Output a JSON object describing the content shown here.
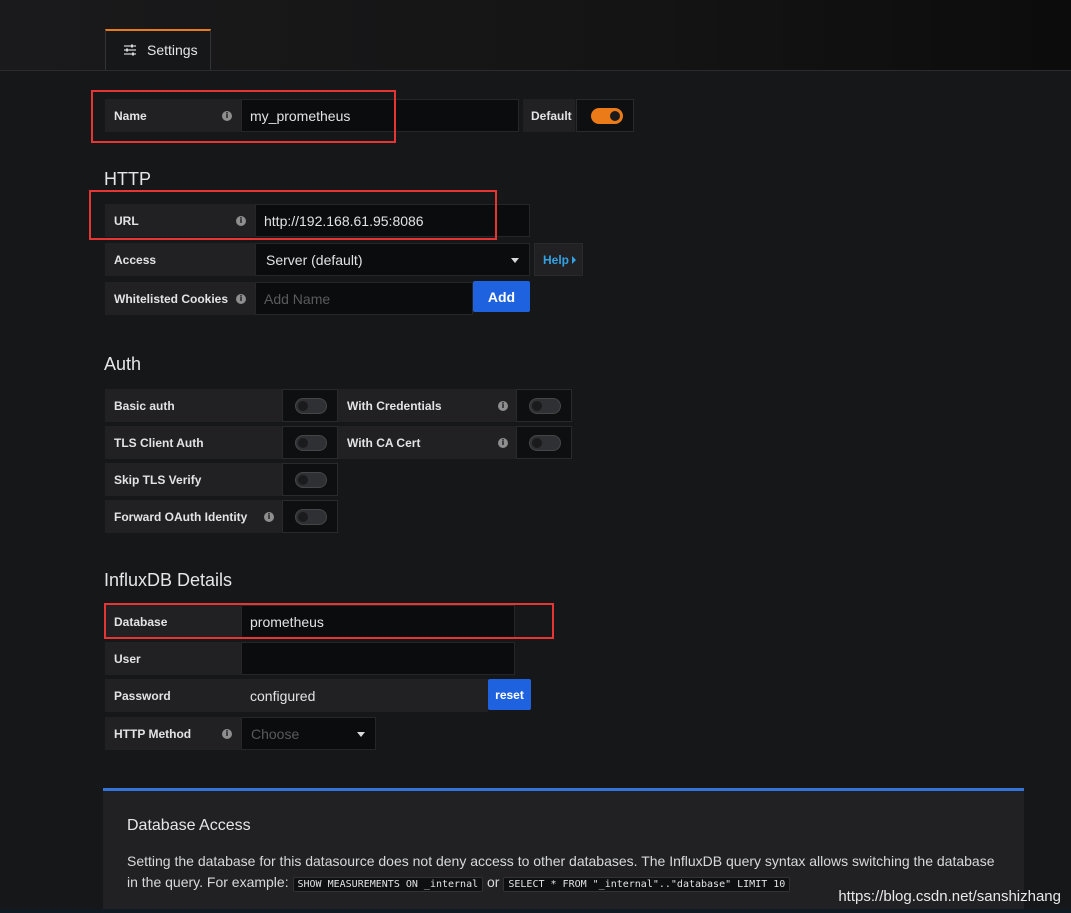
{
  "tab": {
    "label": "Settings",
    "icon": "sliders-icon"
  },
  "name_row": {
    "label": "Name",
    "value": "my_prometheus",
    "default_label": "Default",
    "default_on": true
  },
  "http": {
    "heading": "HTTP",
    "url_label": "URL",
    "url_value": "http://192.168.61.95:8086",
    "access_label": "Access",
    "access_value": "Server (default)",
    "help_label": "Help",
    "cookies_label": "Whitelisted Cookies",
    "cookies_placeholder": "Add Name",
    "add_label": "Add"
  },
  "auth": {
    "heading": "Auth",
    "basic_auth": "Basic auth",
    "with_credentials": "With Credentials",
    "tls_client_auth": "TLS Client Auth",
    "with_ca_cert": "With CA Cert",
    "skip_tls_verify": "Skip TLS Verify",
    "forward_oauth": "Forward OAuth Identity"
  },
  "influx": {
    "heading": "InfluxDB Details",
    "database_label": "Database",
    "database_value": "prometheus",
    "user_label": "User",
    "user_value": "",
    "password_label": "Password",
    "password_value": "configured",
    "reset_label": "reset",
    "method_label": "HTTP Method",
    "method_placeholder": "Choose"
  },
  "info_panel": {
    "title": "Database Access",
    "text_1": "Setting the database for this datasource does not deny access to other databases. The InfluxDB query syntax allows switching the database in the query. For example:",
    "code_1": "SHOW MEASUREMENTS ON _internal",
    "text_or": "or",
    "code_2": "SELECT * FROM \"_internal\"..\"database\" LIMIT 10"
  },
  "watermark": "https://blog.csdn.net/sanshizhang",
  "colors": {
    "accent": "#eb7b18",
    "primary_blue": "#1f62e0",
    "highlight_red": "#e53535"
  }
}
